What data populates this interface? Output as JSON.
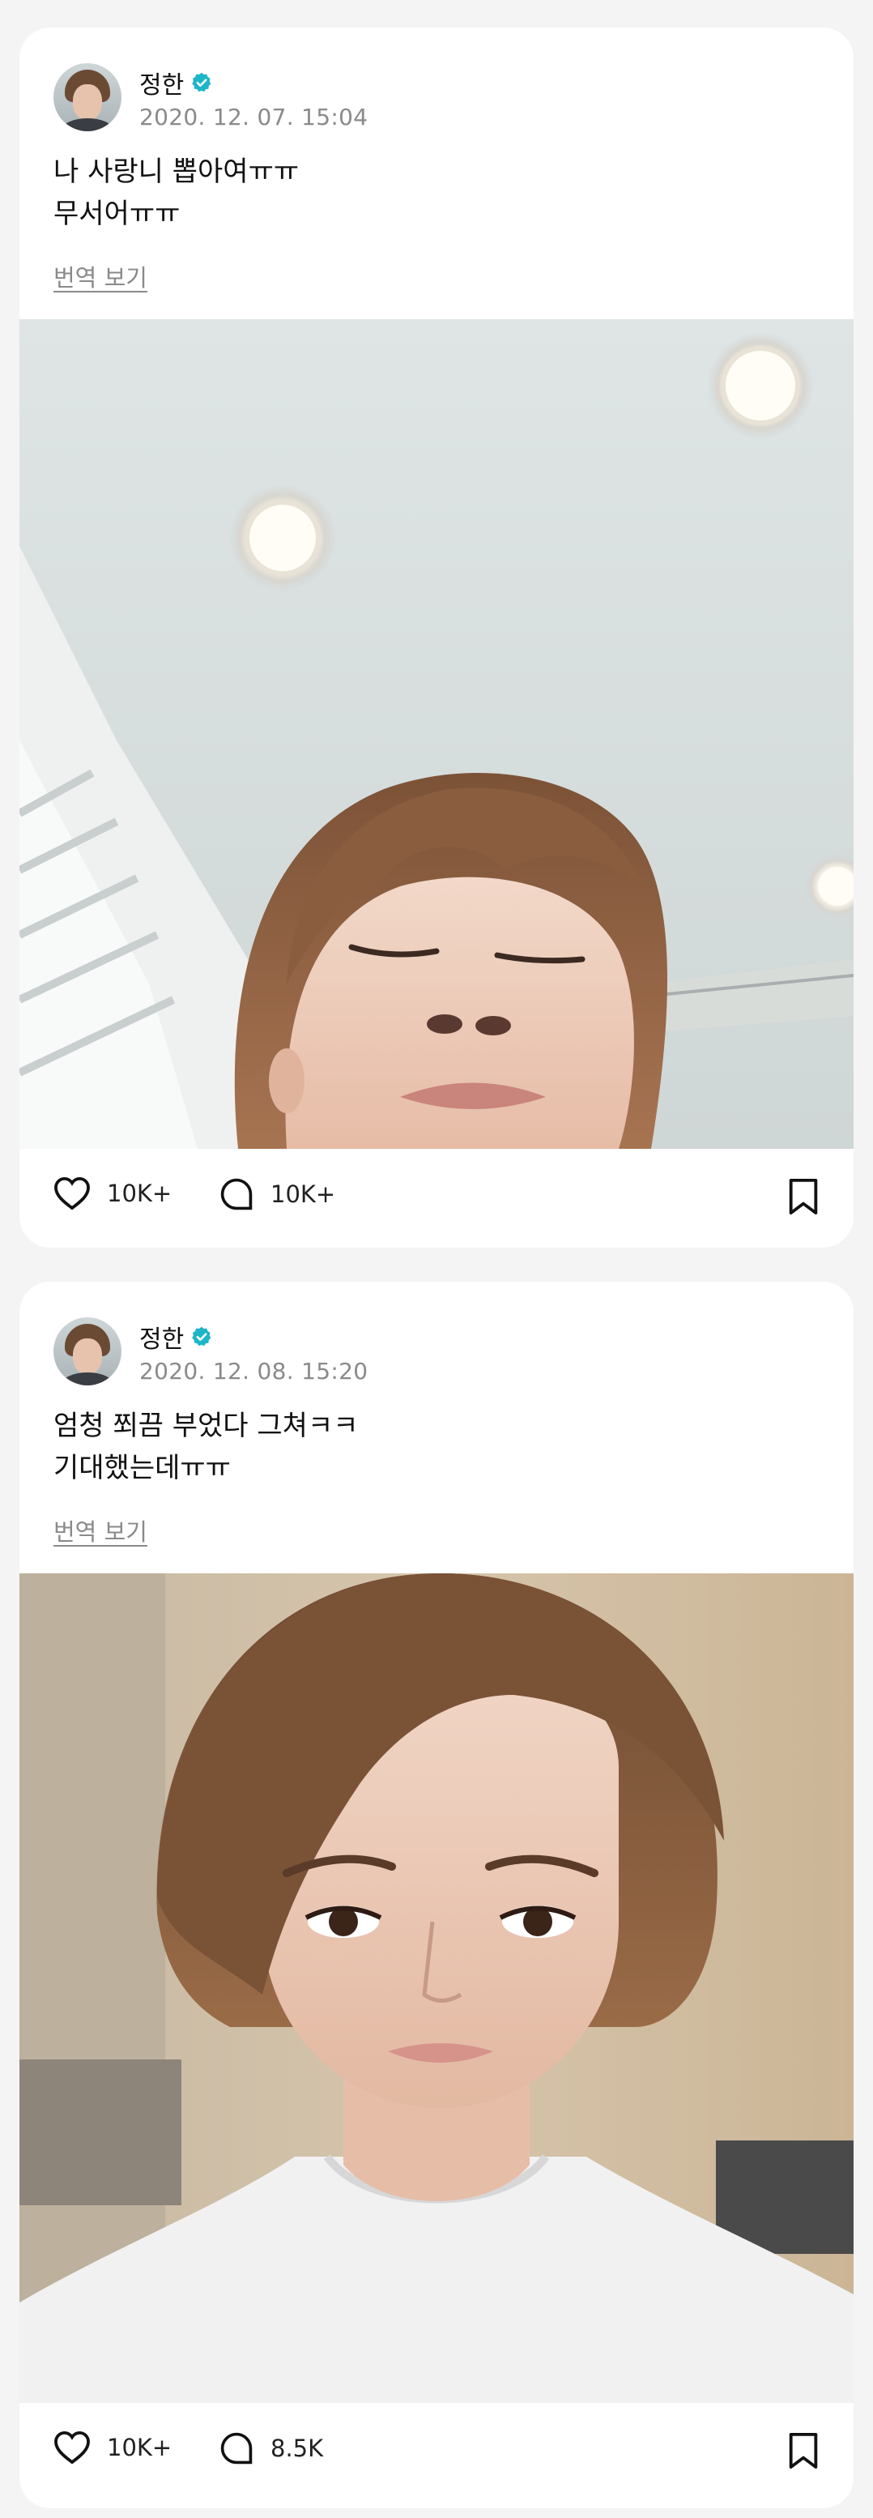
{
  "posts": [
    {
      "author": "정한",
      "verified_icon": "verified-badge-icon",
      "time": "2020. 12. 07. 15:04",
      "text_lines": [
        "나 사랑니 뽑아여ㅠㅠ",
        "무서어ㅠㅠ"
      ],
      "translate_label": "번역 보기",
      "photo_icon": "selfie-photo",
      "likes": "10K+",
      "comments": "10K+"
    },
    {
      "author": "정한",
      "verified_icon": "verified-badge-icon",
      "time": "2020. 12. 08. 15:20",
      "text_lines": [
        "엄청 쬐끔 부었다 그쳐ㅋㅋ",
        "기대했는데ㅠㅠ"
      ],
      "translate_label": "번역 보기",
      "photo_icon": "selfie-photo",
      "likes": "10K+",
      "comments": "8.5K"
    }
  ],
  "colors": {
    "verified": "#1fb5c8",
    "muted_text": "#8a8a8a",
    "card_bg": "#ffffff",
    "page_bg": "#f4f4f4"
  }
}
